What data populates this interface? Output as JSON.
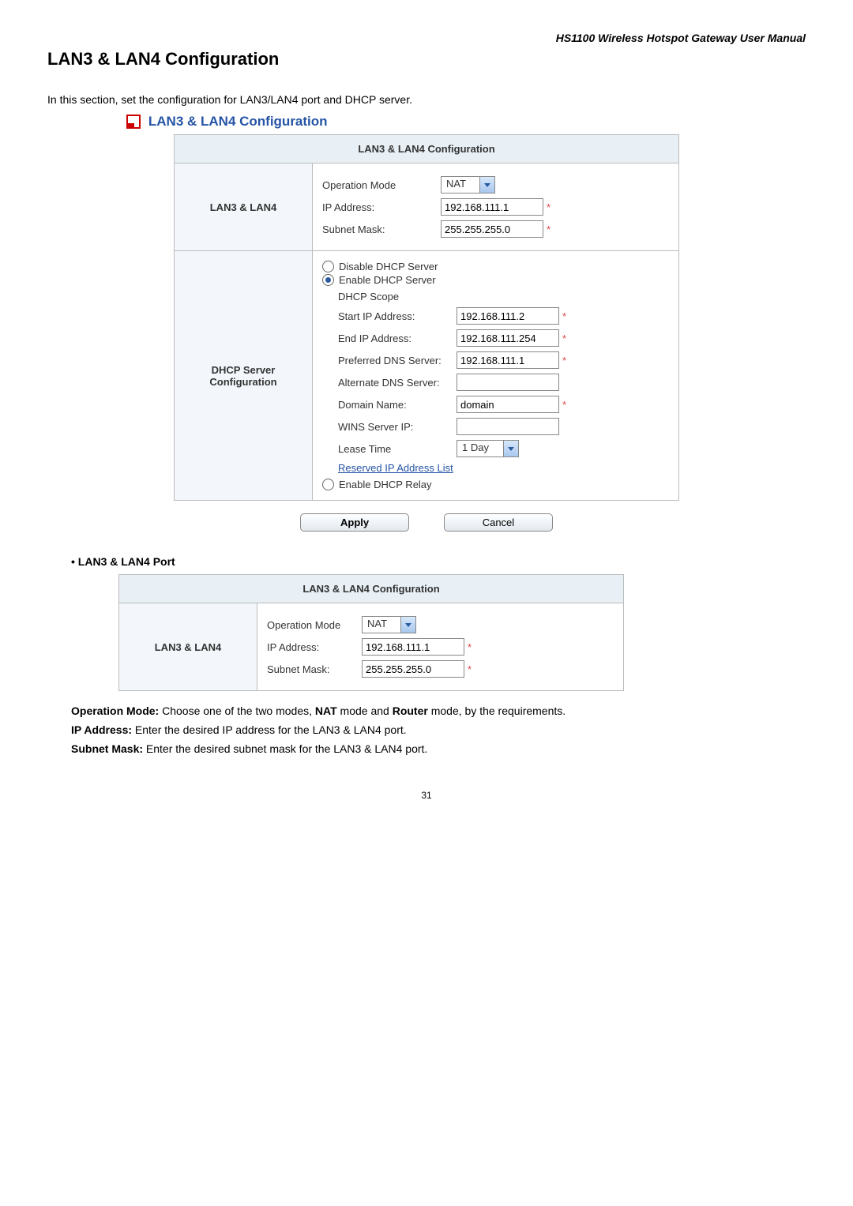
{
  "header": {
    "product_line": "HS1100 Wireless Hotspot Gateway User Manual"
  },
  "title": "LAN3 & LAN4 Configuration",
  "intro": "In this section, set the configuration for LAN3/LAN4 port and DHCP server.",
  "section_heading": "LAN3 & LAN4 Configuration",
  "table1": {
    "header": "LAN3 & LAN4 Configuration",
    "lan_label": "LAN3 & LAN4",
    "op_mode_label": "Operation Mode",
    "op_mode_value": "NAT",
    "ip_label": "IP Address:",
    "ip_value": "192.168.111.1",
    "mask_label": "Subnet Mask:",
    "mask_value": "255.255.255.0",
    "dhcp_label": "DHCP Server Configuration",
    "radio_disable": "Disable DHCP Server",
    "radio_enable": "Enable DHCP Server",
    "scope_label": "DHCP Scope",
    "start_ip_label": "Start IP Address:",
    "start_ip_value": "192.168.111.2",
    "end_ip_label": "End IP Address:",
    "end_ip_value": "192.168.111.254",
    "pref_dns_label": "Preferred DNS Server:",
    "pref_dns_value": "192.168.111.1",
    "alt_dns_label": "Alternate DNS Server:",
    "alt_dns_value": "",
    "domain_label": "Domain Name:",
    "domain_value": "domain",
    "wins_label": "WINS Server IP:",
    "wins_value": "",
    "lease_label": "Lease Time",
    "lease_value": "1 Day",
    "reserved_link": "Reserved IP Address List",
    "radio_relay": "Enable DHCP Relay"
  },
  "buttons": {
    "apply": "Apply",
    "cancel": "Cancel"
  },
  "bullet": {
    "title": "LAN3 & LAN4 Port"
  },
  "table2": {
    "header": "LAN3 & LAN4 Configuration",
    "lan_label": "LAN3 & LAN4",
    "op_mode_label": "Operation Mode",
    "op_mode_value": "NAT",
    "ip_label": "IP Address:",
    "ip_value": "192.168.111.1",
    "mask_label": "Subnet Mask:",
    "mask_value": "255.255.255.0"
  },
  "descriptions": {
    "op_mode_b": "Operation Mode:",
    "op_mode_t1": " Choose one of the two modes, ",
    "op_mode_nat": "NAT",
    "op_mode_t2": " mode and ",
    "op_mode_router": "Router",
    "op_mode_t3": " mode, by the requirements.",
    "ip_b": "IP Address:",
    "ip_t": " Enter the desired IP address for the LAN3 & LAN4 port.",
    "mask_b": "Subnet Mask:",
    "mask_t": " Enter the desired subnet mask for the LAN3 & LAN4 port."
  },
  "page_number": "31"
}
